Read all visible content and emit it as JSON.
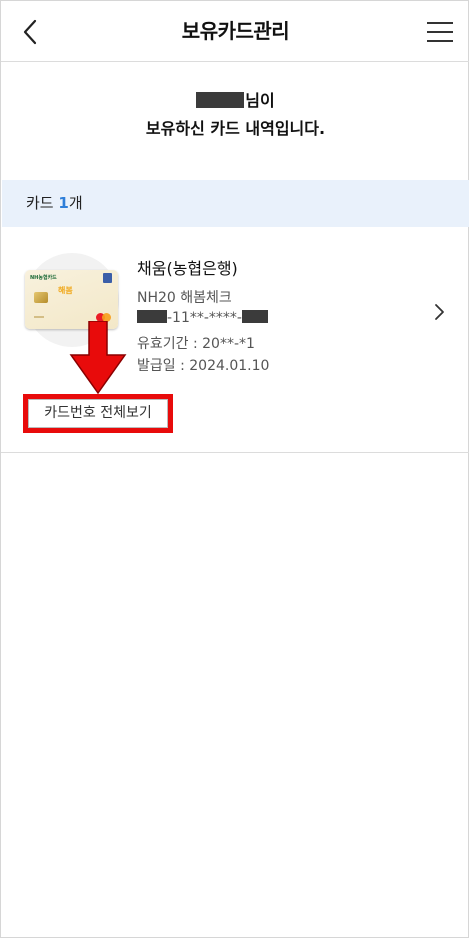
{
  "header": {
    "title": "보유카드관리",
    "back_icon": "chevron-left-icon",
    "menu_icon": "hamburger-menu-icon"
  },
  "greeting": {
    "name_suffix": "님이",
    "message": "보유하신 카드 내역입니다."
  },
  "summary": {
    "label": "카드",
    "count": "1",
    "unit": "개",
    "accent_color": "#2f7fd9"
  },
  "card": {
    "name": "채움(농협은행)",
    "product": "NH20 해봄체크",
    "number_middle": "-11**-****-",
    "expiry": "유효기간 : 20**-*1",
    "issue_date": "발급일 : 2024.01.10",
    "image_brand": "NH농협카드",
    "image_logo": "해봄",
    "detail_icon": "chevron-right-icon"
  },
  "actions": {
    "view_full_number": "카드번호 전체보기",
    "highlight_color": "#e80b0b"
  }
}
